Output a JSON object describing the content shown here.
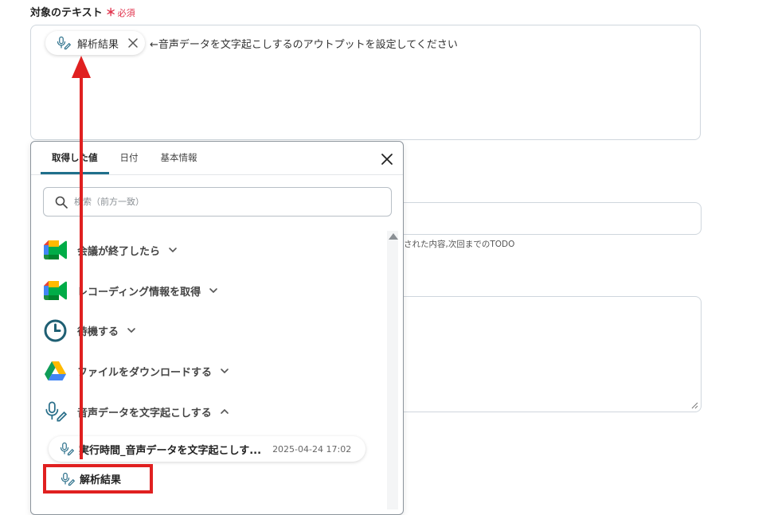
{
  "field": {
    "label": "対象のテキスト",
    "required_mark": "＊",
    "required_text": "必須",
    "chip_label": "解析結果",
    "hint": "←音声データを文字起こしするのアウトプットを設定してください"
  },
  "background": {
    "helper_text": "された内容,次回までのTODO"
  },
  "panel": {
    "tabs": [
      {
        "label": "取得した値",
        "active": true
      },
      {
        "label": "日付",
        "active": false
      },
      {
        "label": "基本情報",
        "active": false
      }
    ],
    "search_placeholder": "検索（前方一致）",
    "items": [
      {
        "label": "会議が終了したら",
        "icon": "google-meet-icon",
        "expanded": false
      },
      {
        "label": "レコーディング情報を取得",
        "icon": "google-meet-icon",
        "expanded": false
      },
      {
        "label": "待機する",
        "icon": "clock-icon",
        "expanded": false
      },
      {
        "label": "ファイルをダウンロードする",
        "icon": "google-drive-icon",
        "expanded": false
      },
      {
        "label": "音声データを文字起こしする",
        "icon": "microphone-pen-icon",
        "expanded": true
      }
    ],
    "sub_item": {
      "label": "実行時間_音声データを文字起こしす...",
      "time": "2025-04-24 17:02"
    },
    "result_item": {
      "label": "解析結果"
    }
  },
  "colors": {
    "accent": "#1f6f8b",
    "required": "#e0304a",
    "highlight": "#e02020"
  }
}
